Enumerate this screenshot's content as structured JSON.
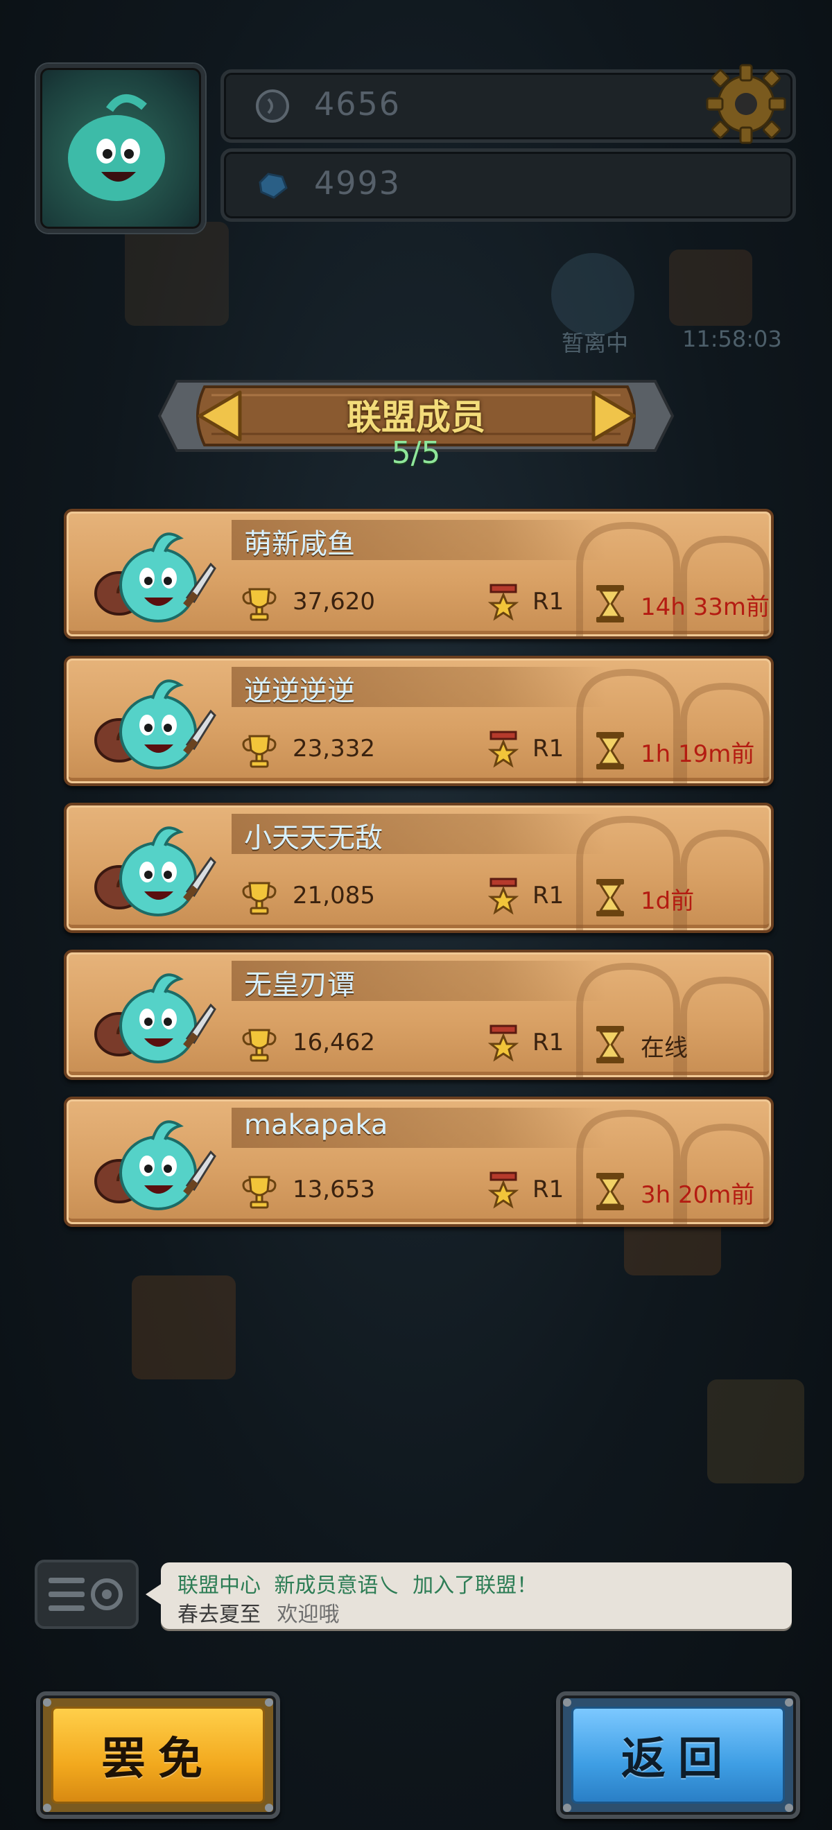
{
  "resources": {
    "coins": "4656",
    "gems": "4993"
  },
  "map_status": {
    "away_label": "暂离中",
    "timer": "11:58:03"
  },
  "panel": {
    "title": "联盟成员",
    "count": "5/5"
  },
  "members": [
    {
      "name": "萌新咸鱼",
      "trophies": "37,620",
      "rank": "R1",
      "last_seen": "14h 33m前",
      "online": false
    },
    {
      "name": "逆逆逆逆",
      "trophies": "23,332",
      "rank": "R1",
      "last_seen": "1h 19m前",
      "online": false
    },
    {
      "name": "小天天无敌",
      "trophies": "21,085",
      "rank": "R1",
      "last_seen": "1d前",
      "online": false
    },
    {
      "name": "无皇刃谭",
      "trophies": "16,462",
      "rank": "R1",
      "last_seen": "在线",
      "online": true
    },
    {
      "name": "makapaka",
      "trophies": "13,653",
      "rank": "R1",
      "last_seen": "3h 20m前",
      "online": false
    }
  ],
  "chat": {
    "line1_sender": "联盟中心",
    "line1_name": "新成员意语乀",
    "line1_text": "加入了联盟！",
    "line2_sender": "春去夏至",
    "line2_text": "欢迎哦"
  },
  "buttons": {
    "dismiss": "罢免",
    "back": "返回"
  },
  "colors": {
    "name_text": "#d8f1ff",
    "last_seen_red": "#b41c12",
    "dismiss_button": "#f2a91e",
    "back_button": "#3e9ee4",
    "count_green": "#8fe69a"
  },
  "icons": [
    "gear-icon",
    "coin-icon",
    "gem-icon",
    "arrow-left-icon",
    "arrow-right-icon",
    "trophy-icon",
    "rank-medal-icon",
    "hourglass-icon",
    "chat-icon"
  ]
}
